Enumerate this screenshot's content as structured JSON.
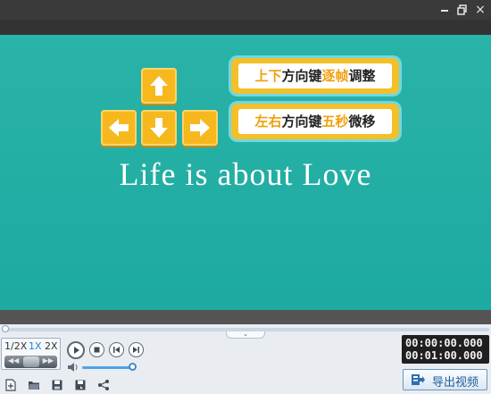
{
  "titlebar": {
    "minimize_icon": "minimize-icon",
    "restore_icon": "restore-icon",
    "close_icon": "close-icon",
    "close_glyph": "×"
  },
  "preview": {
    "background_color": "#1fada3",
    "keys": [
      "arrow-up-key",
      "arrow-left-key",
      "arrow-down-key",
      "arrow-right-key"
    ],
    "key_color": "#f6b81c",
    "hint_up_down": {
      "prefix": "上下",
      "middle": "方向键",
      "highlight": "逐帧",
      "suffix": "调整"
    },
    "hint_left_right": {
      "prefix": "左右",
      "middle": "方向键",
      "highlight": "五秒",
      "suffix": "微移"
    },
    "caption": "Life is about Love"
  },
  "controls": {
    "collapse_glyph": "⌄",
    "speeds": [
      "1/2X",
      "1X",
      "2X"
    ],
    "active_speed": "1X",
    "jog_left": "◀◀",
    "jog_right": "▶▶",
    "timeline_progress": 0,
    "volume_level": 0.9,
    "current_time": "00:00:00.000",
    "total_time": "00:01:00.000",
    "accent_color": "#1d86d8"
  },
  "toolbar": {
    "icons": [
      "new-project-icon",
      "open-folder-icon",
      "save-icon",
      "save-as-icon",
      "share-icon"
    ]
  },
  "export": {
    "label": "导出视频"
  }
}
